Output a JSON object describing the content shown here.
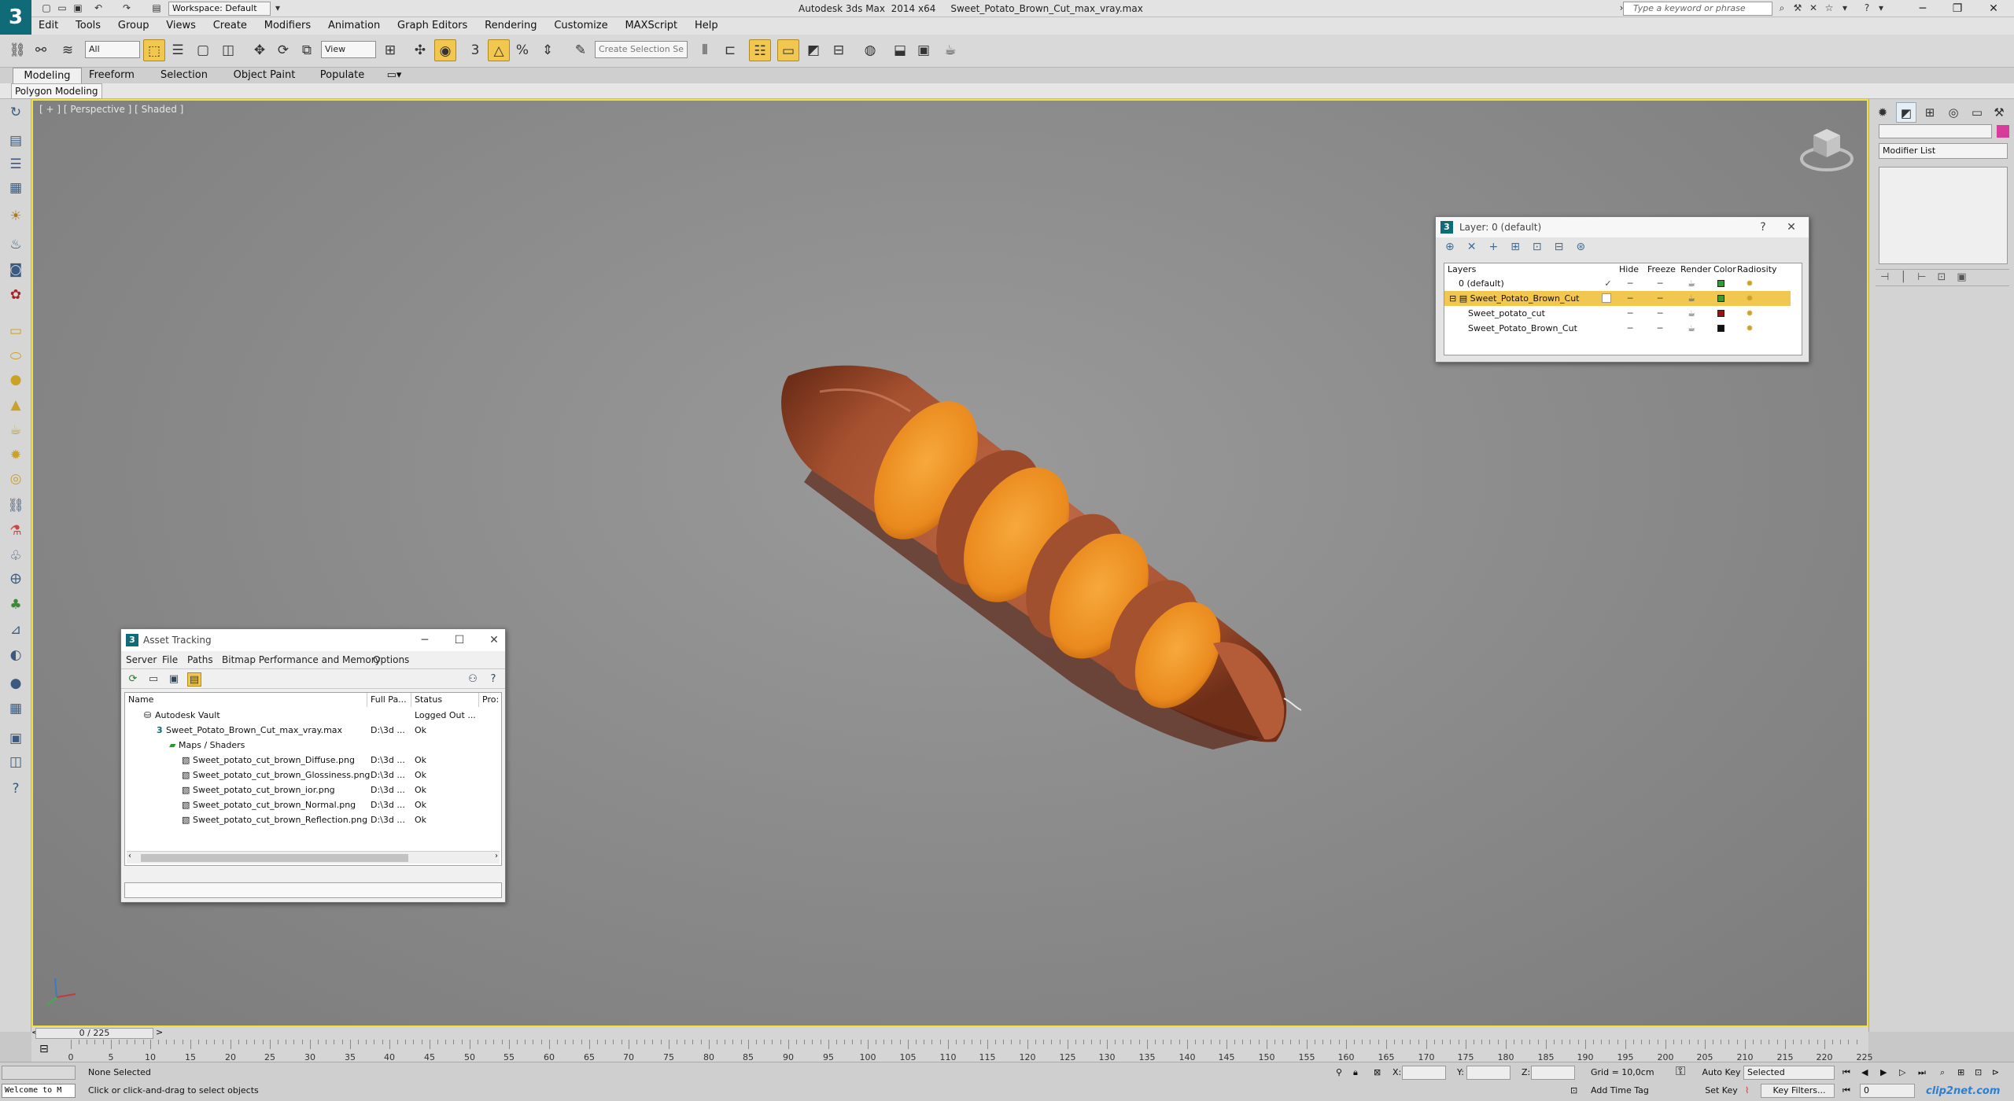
{
  "titlebar": {
    "logo": "3",
    "workspace": "Workspace: Default",
    "app_title": "Autodesk 3ds Max  2014 x64     Sweet_Potato_Brown_Cut_max_vray.max",
    "search_placeholder": "Type a keyword or phrase"
  },
  "menu": [
    "Edit",
    "Tools",
    "Group",
    "Views",
    "Create",
    "Modifiers",
    "Animation",
    "Graph Editors",
    "Rendering",
    "Customize",
    "MAXScript",
    "Help"
  ],
  "toolbar": {
    "filter_value": "All",
    "refcoord_value": "View",
    "selection_set_placeholder": "Create Selection Se"
  },
  "ribbon": {
    "tabs": [
      "Modeling",
      "Freeform",
      "Selection",
      "Object Paint",
      "Populate"
    ],
    "active_sub": "Polygon Modeling"
  },
  "viewport": {
    "label": "[ + ] [ Perspective ] [ Shaded ]"
  },
  "command_panel": {
    "modifier_list": "Modifier List",
    "swatch_color": "#d83c9b"
  },
  "layer_dialog": {
    "title": "Layer: 0 (default)",
    "columns": [
      "Layers",
      "Hide",
      "Freeze",
      "Render",
      "Color",
      "Radiosity"
    ],
    "rows": [
      {
        "name": "0 (default)",
        "color": "#2f9e2f",
        "current": "✓"
      },
      {
        "name": "Sweet_Potato_Brown_Cut",
        "color": "#3c9a2a",
        "current": ""
      },
      {
        "name": "Sweet_potato_cut",
        "color": "#9b1010",
        "current": ""
      },
      {
        "name": "Sweet_Potato_Brown_Cut",
        "color": "#111111",
        "current": ""
      }
    ]
  },
  "asset_dialog": {
    "title": "Asset Tracking",
    "menu": [
      "Server",
      "File",
      "Paths",
      "Bitmap Performance and Memory",
      "Options"
    ],
    "columns": [
      "Name",
      "Full Pa...",
      "Status",
      "Pro:"
    ],
    "rows": [
      {
        "name": "Autodesk Vault",
        "path": "",
        "status": "Logged Out ..."
      },
      {
        "name": "Sweet_Potato_Brown_Cut_max_vray.max",
        "path": "D:\\3d ...",
        "status": "Ok"
      },
      {
        "name": "Maps / Shaders",
        "path": "",
        "status": ""
      },
      {
        "name": "Sweet_potato_cut_brown_Diffuse.png",
        "path": "D:\\3d ...",
        "status": "Ok"
      },
      {
        "name": "Sweet_potato_cut_brown_Glossiness.png",
        "path": "D:\\3d ...",
        "status": "Ok"
      },
      {
        "name": "Sweet_potato_cut_brown_ior.png",
        "path": "D:\\3d ...",
        "status": "Ok"
      },
      {
        "name": "Sweet_potato_cut_brown_Normal.png",
        "path": "D:\\3d ...",
        "status": "Ok"
      },
      {
        "name": "Sweet_potato_cut_brown_Reflection.png",
        "path": "D:\\3d ...",
        "status": "Ok"
      }
    ]
  },
  "timeline": {
    "slider": "0 / 225",
    "ticks": [
      "0",
      "5",
      "10",
      "15",
      "20",
      "25",
      "30",
      "35",
      "40",
      "45",
      "50",
      "55",
      "60",
      "65",
      "70",
      "75",
      "80",
      "85",
      "90",
      "95",
      "100",
      "105",
      "110",
      "115",
      "120",
      "125",
      "130",
      "135",
      "140",
      "145",
      "150",
      "155",
      "160",
      "165",
      "170",
      "175",
      "180",
      "185",
      "190",
      "195",
      "200",
      "205",
      "210",
      "215",
      "220",
      "225"
    ]
  },
  "status": {
    "maxscript": "Welcome to M",
    "selection": "None Selected",
    "prompt": "Click or click-and-drag to select objects",
    "x_label": "X:",
    "y_label": "Y:",
    "z_label": "Z:",
    "grid": "Grid = 10,0cm",
    "add_time_tag": "Add Time Tag",
    "auto_key": "Auto Key",
    "set_key": "Set Key",
    "selected": "Selected",
    "key_filters": "Key Filters...",
    "frame": "0"
  },
  "watermark": "clip2net.com"
}
